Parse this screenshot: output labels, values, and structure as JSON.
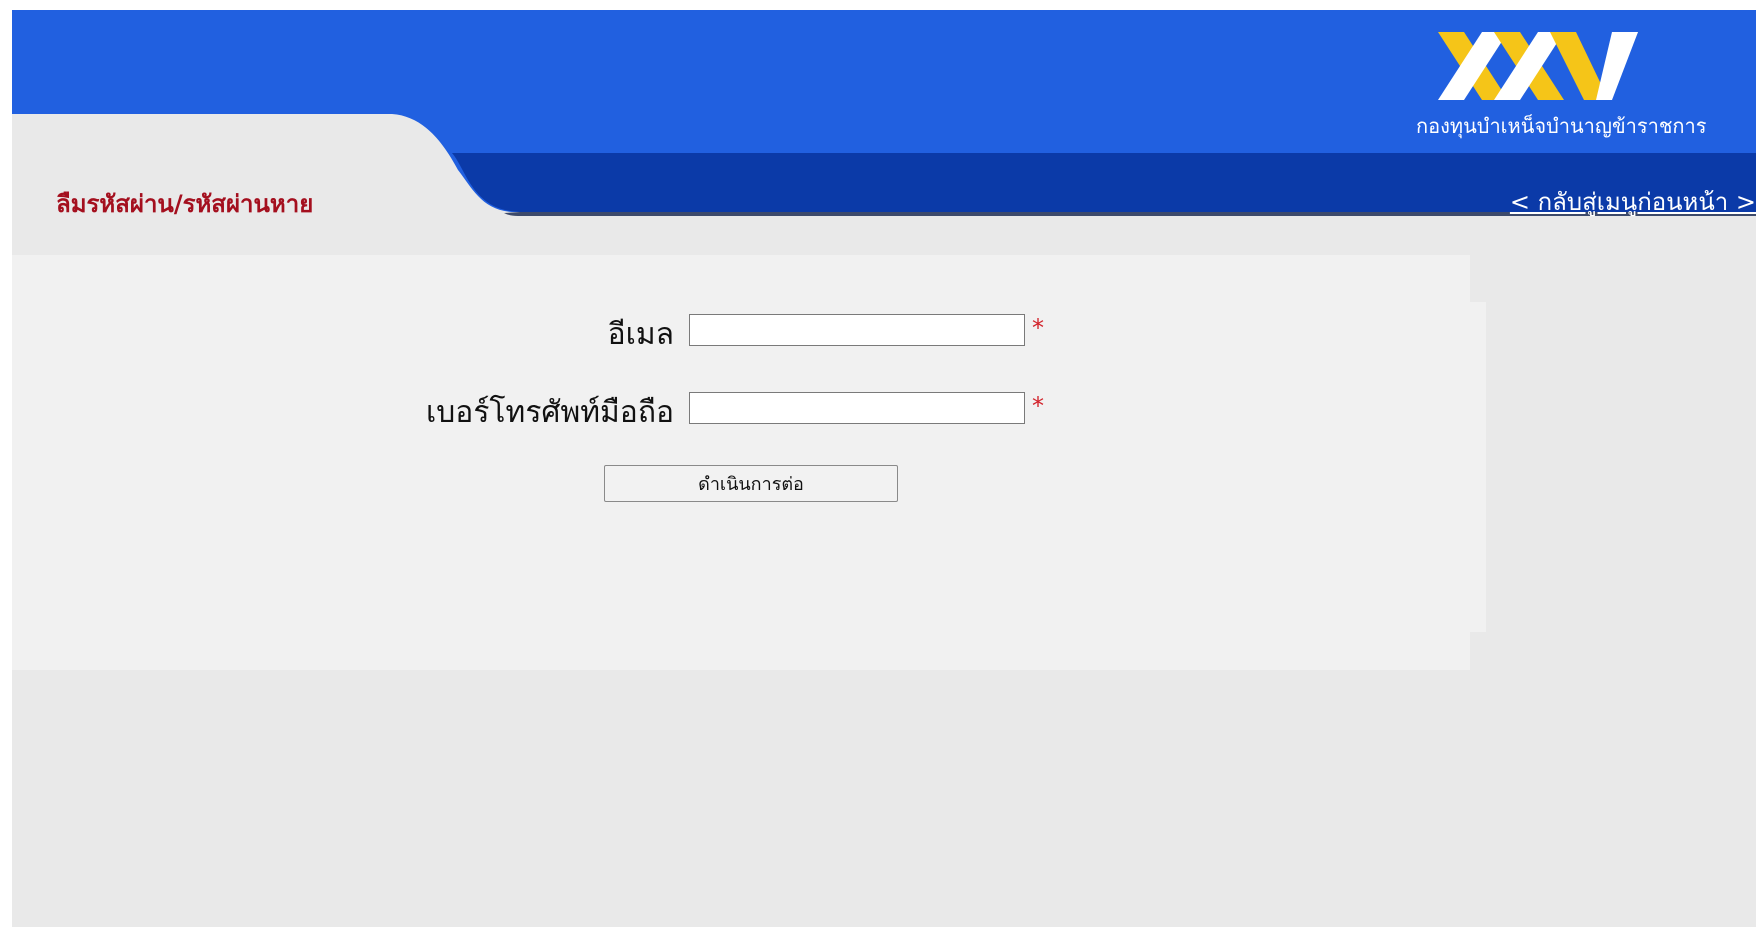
{
  "header": {
    "logo_icon": "xxv-logo-icon",
    "logo_text": "กองทุนบำเหน็จบำนาญข้าราชการ",
    "page_title": "ลืมรหัสผ่าน/รหัสผ่านหาย",
    "back_link": "< กลับสู่เมนูก่อนหน้า >"
  },
  "form": {
    "email_label": "อีเมล",
    "email_value": "",
    "phone_label": "เบอร์โทรศัพท์มือถือ",
    "phone_value": "",
    "required_mark": "*",
    "submit_label": "ดำเนินการต่อ"
  },
  "colors": {
    "header_blue": "#2160e0",
    "header_dark_blue": "#0b3aa8",
    "title_red": "#a40f1e",
    "logo_gold": "#f5c518",
    "page_gray": "#e9e9e9",
    "required_red": "#d2222a"
  }
}
